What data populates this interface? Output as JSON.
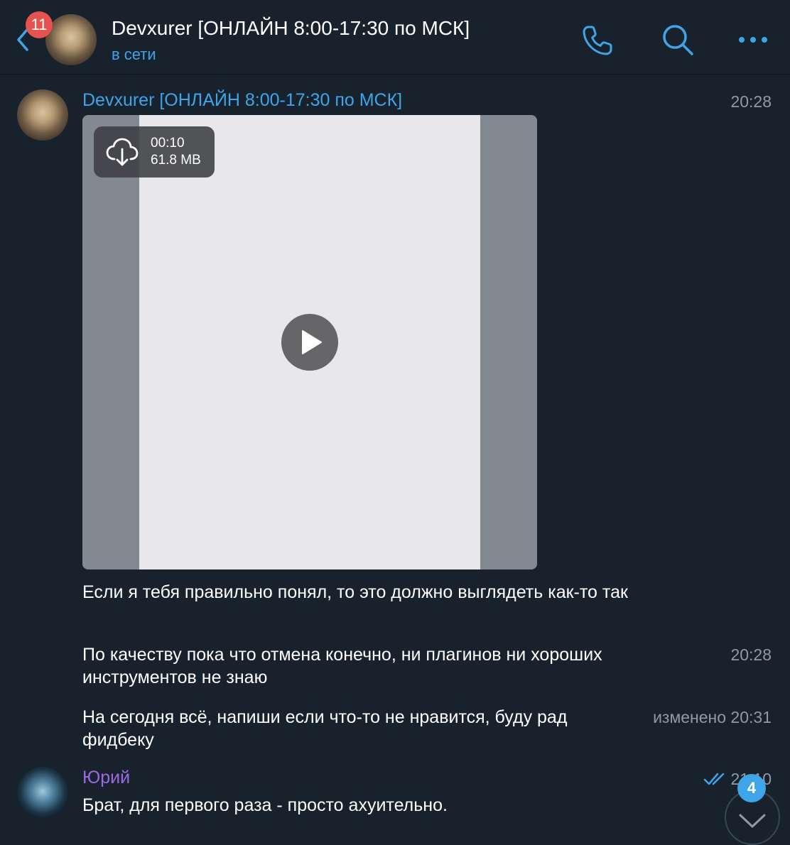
{
  "header": {
    "unread_count": "11",
    "title": "Devxurer [ОНЛАЙН 8:00-17:30 по МСК]",
    "status": "в сети"
  },
  "messages": [
    {
      "sender": "Devxurer [ОНЛАЙН 8:00-17:30 по МСК]",
      "time": "20:28",
      "video": {
        "duration": "00:10",
        "size": "61.8 MB"
      }
    },
    {
      "text": "Если я тебя правильно понял, то это должно выглядеть как-то так"
    },
    {
      "text": "По качеству пока что отмена конечно, ни плагинов ни хороших инструментов не знаю",
      "time": "20:28"
    },
    {
      "text": "На сегодня всё, напиши если что-то не нравится, буду рад фидбеку",
      "time": "изменено 20:31"
    },
    {
      "sender": "Юрий",
      "text": "Брат, для первого раза - просто ахуительно.",
      "time": "21:10"
    }
  ],
  "scroll_down": {
    "unread_count": "4"
  },
  "colors": {
    "background": "#18222d",
    "accent": "#3fa4e8",
    "badge_red": "#e5524f",
    "sender2": "#9b6ae2",
    "muted": "#8f9aa6"
  },
  "icons": [
    "back-arrow-icon",
    "call-icon",
    "search-icon",
    "more-icon",
    "cloud-download-icon",
    "play-icon",
    "double-check-icon",
    "chevron-down-icon"
  ]
}
